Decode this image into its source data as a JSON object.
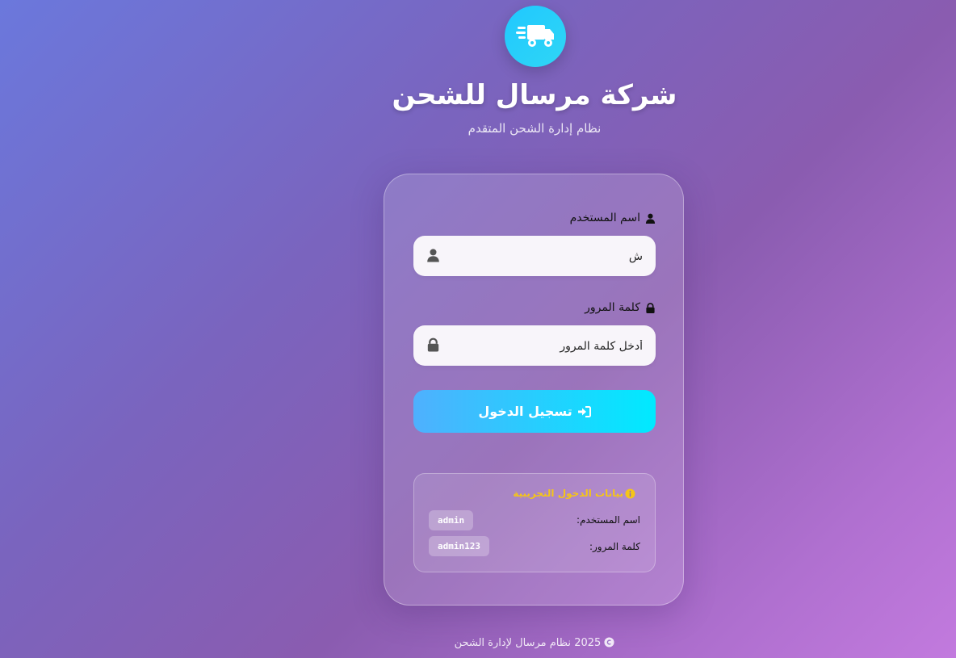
{
  "brand": {
    "logo_icon": "shipping-fast-icon",
    "title": "شركة مرسال للشحن",
    "subtitle": "نظام إدارة الشحن المتقدم"
  },
  "login_form": {
    "username": {
      "label": "اسم المستخدم",
      "label_icon": "user-icon",
      "value": "ش",
      "placeholder": "",
      "input_icon": "user-icon"
    },
    "password": {
      "label": "كلمة المرور",
      "label_icon": "lock-icon",
      "value": "",
      "placeholder": "أدخل كلمة المرور",
      "input_icon": "lock-icon"
    },
    "submit_label": "تسجيل الدخول",
    "submit_icon": "sign-in-icon"
  },
  "demo_credentials": {
    "title": "بيانات الدخول التجريبية",
    "title_icon": "info-circle-icon",
    "username_label": "اسم المستخدم:",
    "username_value": "admin",
    "password_label": "كلمة المرور:",
    "password_value": "admin123"
  },
  "footer": {
    "icon": "copyright-icon",
    "text": "2025 نظام مرسال لإدارة الشحن"
  },
  "colors": {
    "accent_cyan": "#00eaff",
    "accent_blue": "#4fb0fe",
    "warning_yellow": "#f5c518",
    "background_start": "#6b78dc",
    "background_end": "#c27ade"
  }
}
